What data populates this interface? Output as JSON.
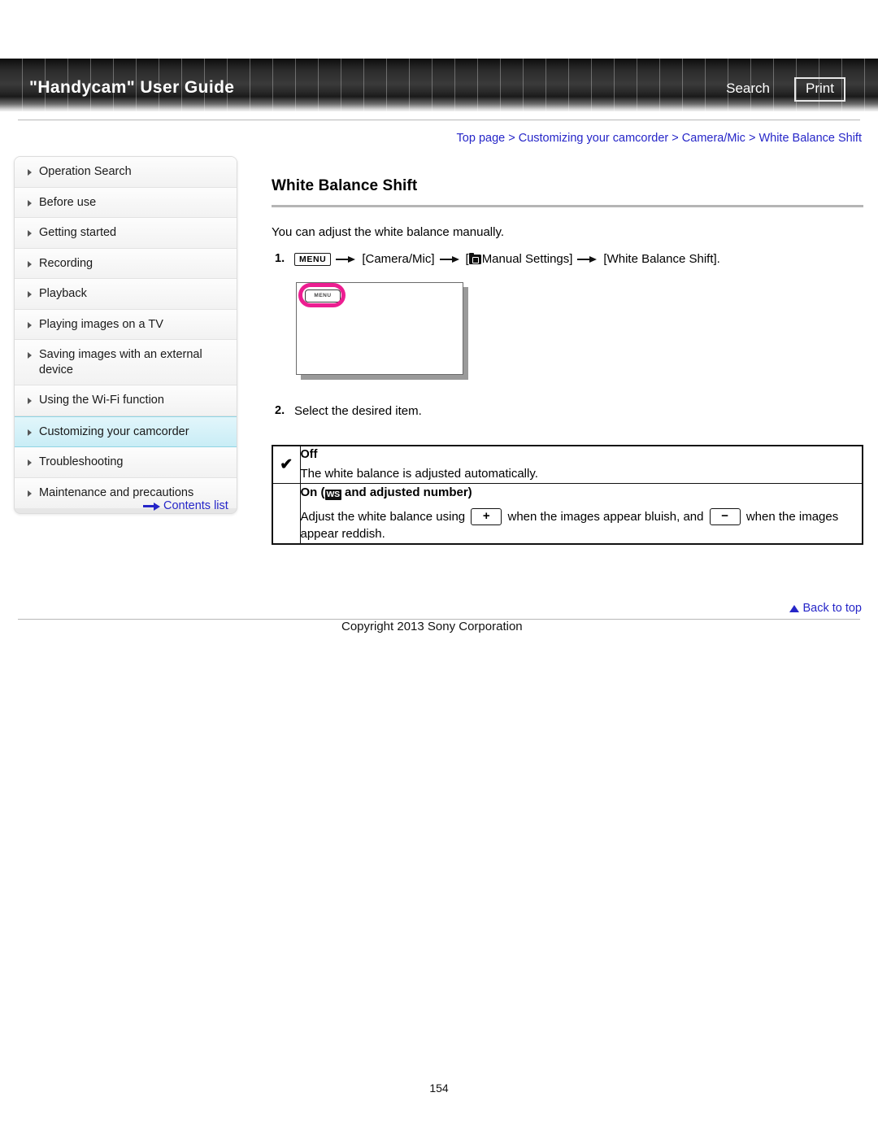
{
  "header": {
    "title": "\"Handycam\" User Guide",
    "search_label": "Search",
    "print_label": "Print"
  },
  "breadcrumb": {
    "text": "Top page > Customizing your camcorder > Camera/Mic > White Balance Shift",
    "items": [
      "Top page",
      "Customizing your camcorder",
      "Camera/Mic",
      "White Balance Shift"
    ],
    "separator": ">",
    "color": "#2626c8"
  },
  "sidebar": {
    "items": [
      {
        "label": "Operation Search",
        "active": false
      },
      {
        "label": "Before use",
        "active": false
      },
      {
        "label": "Getting started",
        "active": false
      },
      {
        "label": "Recording",
        "active": false
      },
      {
        "label": "Playback",
        "active": false
      },
      {
        "label": "Playing images on a TV",
        "active": false
      },
      {
        "label": "Saving images with an external device",
        "active": false
      },
      {
        "label": "Using the Wi-Fi function",
        "active": false
      },
      {
        "label": "Customizing your camcorder",
        "active": true
      },
      {
        "label": "Troubleshooting",
        "active": false
      },
      {
        "label": "Maintenance and precautions",
        "active": false
      }
    ],
    "contents_list_label": "Contents list",
    "active_color": "#c9edf6"
  },
  "main": {
    "page_title": "White Balance Shift",
    "intro": "You can adjust the white balance manually.",
    "step1": {
      "number": "1.",
      "menu_chip": "MENU",
      "part_camera_mic": "[Camera/Mic]",
      "bracket_open": "[",
      "manual_settings": "Manual Settings]",
      "white_balance_shift": "[White Balance Shift]."
    },
    "illustration": {
      "menu_chip": "MENU",
      "highlight_color": "#ec1e91"
    },
    "step2": {
      "number": "2.",
      "text": "Select the desired item."
    },
    "options_table": {
      "rows": [
        {
          "check": "✔",
          "title": "Off",
          "body": "The white balance is adjusted automatically."
        },
        {
          "check": "",
          "title_prefix": "On (",
          "title_icon": "WS",
          "title_suffix": " and adjusted number)",
          "body_part1": "Adjust the white balance using",
          "plus_chip": "+",
          "body_part2": "when the images appear bluish, and",
          "minus_chip": "−",
          "body_part3": "when the images appear reddish."
        }
      ]
    }
  },
  "footer": {
    "back_to_top": "Back to top",
    "copyright": "Copyright 2013 Sony Corporation",
    "page_number": "154"
  }
}
